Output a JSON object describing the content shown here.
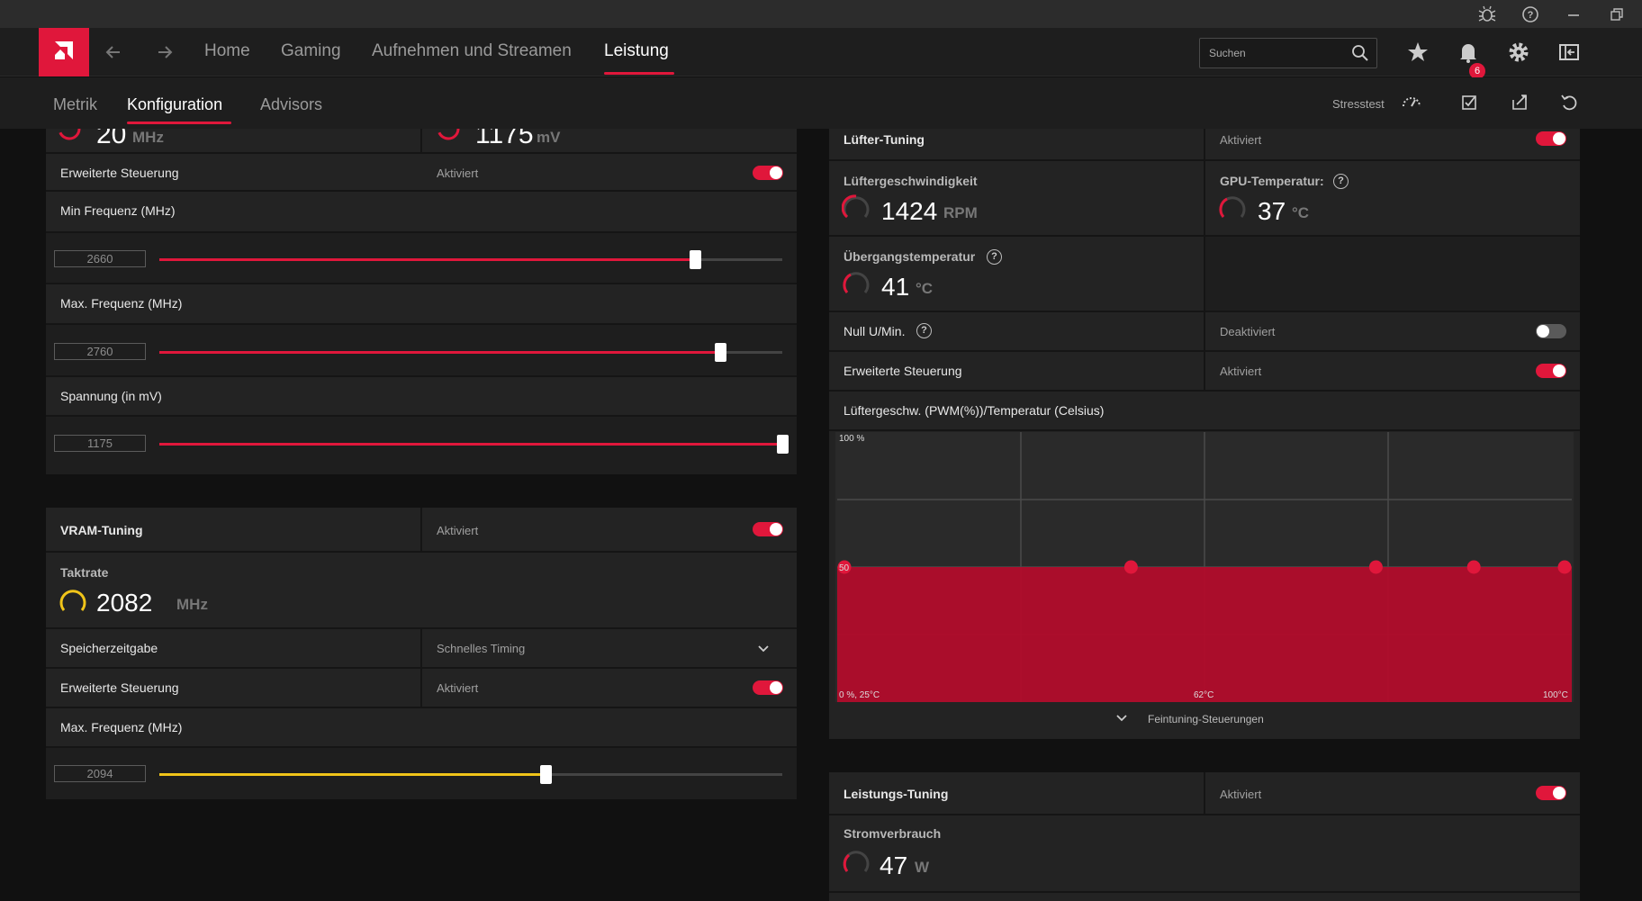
{
  "nav": {
    "home": "Home",
    "gaming": "Gaming",
    "streaming": "Aufnehmen und Streamen",
    "performance": "Leistung"
  },
  "search": {
    "placeholder": "Suchen"
  },
  "notifications": {
    "count": "6"
  },
  "subnav": {
    "metrics": "Metrik",
    "config": "Konfiguration",
    "advisors": "Advisors",
    "stresstest": "Stresstest"
  },
  "gpu_tuning": {
    "partial_value_1": "20",
    "partial_unit_1": "MHz",
    "partial_value_2": "1175",
    "partial_unit_2": "mV",
    "advanced_label": "Erweiterte Steuerung",
    "advanced_status": "Aktiviert",
    "min_freq_label": "Min Frequenz (MHz)",
    "min_freq_value": "2660",
    "min_freq_fraction": 0.86,
    "max_freq_label": "Max. Frequenz (MHz)",
    "max_freq_value": "2760",
    "max_freq_fraction": 0.9,
    "voltage_label": "Spannung (in mV)",
    "voltage_value": "1175",
    "voltage_fraction": 1.0
  },
  "vram_tuning": {
    "title": "VRAM-Tuning",
    "status": "Aktiviert",
    "clock_label": "Taktrate",
    "clock_value": "2082",
    "clock_unit": "MHz",
    "timing_label": "Speicherzeitgabe",
    "timing_value": "Schnelles Timing",
    "advanced_label": "Erweiterte Steuerung",
    "advanced_status": "Aktiviert",
    "max_freq_label": "Max. Frequenz (MHz)",
    "max_freq_value": "2094",
    "max_freq_fraction": 0.62
  },
  "fan_tuning": {
    "title": "Lüfter-Tuning",
    "status": "Aktiviert",
    "fan_speed_label": "Lüftergeschwindigkeit",
    "fan_speed_value": "1424",
    "fan_speed_unit": "RPM",
    "gpu_temp_label": "GPU-Temperatur:",
    "gpu_temp_value": "37",
    "gpu_temp_unit": "°C",
    "junction_label": "Übergangstemperatur",
    "junction_value": "41",
    "junction_unit": "°C",
    "zero_rpm_label": "Null U/Min.",
    "zero_rpm_status": "Deaktiviert",
    "advanced_label": "Erweiterte Steuerung",
    "advanced_status": "Aktiviert",
    "curve_label": "Lüftergeschw. (PWM(%))/Temperatur (Celsius)",
    "fine_tune_label": "Feintuning-Steuerungen"
  },
  "chart_data": {
    "type": "area",
    "title": "Lüftergeschw. (PWM(%))/Temperatur (Celsius)",
    "x": [
      25,
      55,
      80,
      90,
      100
    ],
    "y": [
      50,
      50,
      50,
      50,
      50
    ],
    "xlim": [
      25,
      100
    ],
    "ylim": [
      0,
      100
    ],
    "labels": {
      "top_left": "100 %",
      "mid_left": "50",
      "bottom_left": "0 %, 25°C",
      "bottom_mid": "62°C",
      "bottom_right": "100°C"
    },
    "grid": true,
    "color": "#b10c2b",
    "point_color": "#e0173b"
  },
  "power_tuning": {
    "title": "Leistungs-Tuning",
    "status": "Aktiviert",
    "power_label": "Stromverbrauch",
    "power_value": "47",
    "power_unit": "W"
  },
  "colors": {
    "accent": "#e0173b",
    "yellow": "#f0c419"
  }
}
